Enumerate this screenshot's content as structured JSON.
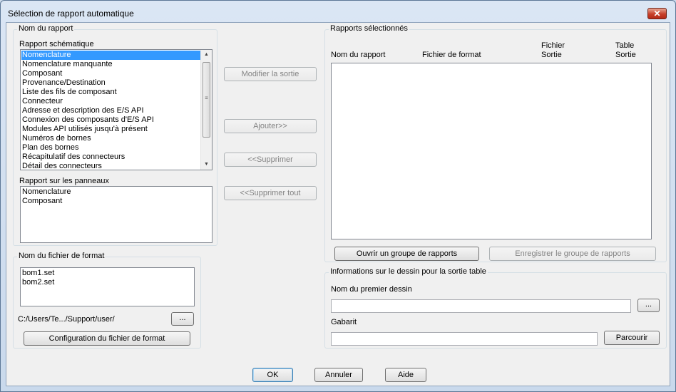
{
  "window": {
    "title": "Sélection de rapport automatique",
    "close_label": "✕"
  },
  "report_name_group": {
    "title": "Nom du rapport",
    "schematic_label": "Rapport schématique",
    "schematic_items": [
      "Nomenclature",
      "Nomenclature manquante",
      "Composant",
      "Provenance/Destination",
      "Liste des fils de composant",
      "Connecteur",
      "Adresse et description des E/S API",
      "Connexion des composants d'E/S API",
      "Modules API utilisés jusqu'à présent",
      "Numéros de bornes",
      "Plan des bornes",
      "Récapitulatif des connecteurs",
      "Détail des connecteurs"
    ],
    "schematic_selected": "Nomenclature",
    "panel_label": "Rapport sur les panneaux",
    "panel_items": [
      "Nomenclature",
      "Composant"
    ]
  },
  "middle_buttons": {
    "modify": "Modifier la sortie",
    "add": "Ajouter>>",
    "remove": "<<Supprimer",
    "remove_all": "<<Supprimer tout"
  },
  "format_group": {
    "title": "Nom du fichier de format",
    "files": [
      "bom1.set",
      "bom2.set"
    ],
    "path": "C:/Users/Te.../Support/user/",
    "browse": "...",
    "config_button": "Configuration du fichier de format"
  },
  "selected_group": {
    "title": "Rapports sélectionnés",
    "col_name": "Nom du rapport",
    "col_format": "Fichier de format",
    "col_file_1": "Fichier",
    "col_file_2": "Sortie",
    "col_table_1": "Table",
    "col_table_2": "Sortie",
    "open_group": "Ouvrir un groupe de rapports",
    "save_group": "Enregistrer le groupe de rapports"
  },
  "drawing_group": {
    "title": "Informations sur le dessin pour la sortie table",
    "first_drawing_label": "Nom du premier dessin",
    "first_drawing_value": "",
    "browse": "...",
    "template_label": "Gabarit",
    "template_value": "",
    "browse_template": "Parcourir"
  },
  "footer": {
    "ok": "OK",
    "cancel": "Annuler",
    "help": "Aide"
  }
}
